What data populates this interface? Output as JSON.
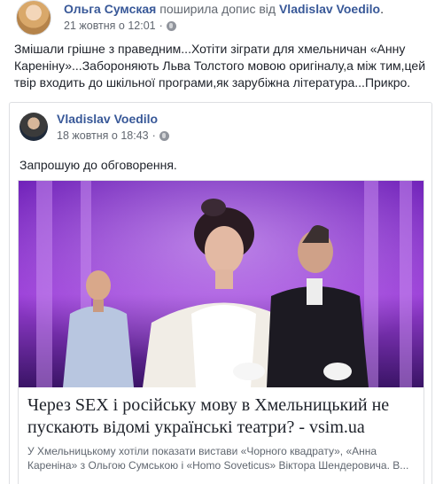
{
  "header": {
    "author": "Ольга Сумская",
    "verb": "поширила допис від",
    "original_author": "Vladislav Voedilo",
    "timestamp": "21 жовтня о 12:01",
    "privacy_icon": "globe-icon"
  },
  "share_text": "Змішали грішне з праведним...Хотіти зіграти для хмельничан «Анну Кареніну»...Забороняють Льва Толстого мовою оригіналу,а між тим,цей твір входить до шкільної програми,як зарубіжна література...Прикро.",
  "original_post": {
    "author": "Vladislav Voedilo",
    "timestamp": "18 жовтня о 18:43",
    "privacy_icon": "globe-icon",
    "text": "Запрошую до обговорення.",
    "link": {
      "title": "Через SEX і російську мову в Хмельницький не пускають відомі українські театри? - vsim.ua",
      "description": "У Хмельницькому хотіли показати вистави «Чорного квадрату», «Анна Кареніна» з Ольгою Сумською і «Homo Soveticus» Віктора Шендеровича. В..."
    }
  },
  "colors": {
    "link_blue": "#385898",
    "meta_gray": "#616770",
    "border": "#dddfe2"
  }
}
